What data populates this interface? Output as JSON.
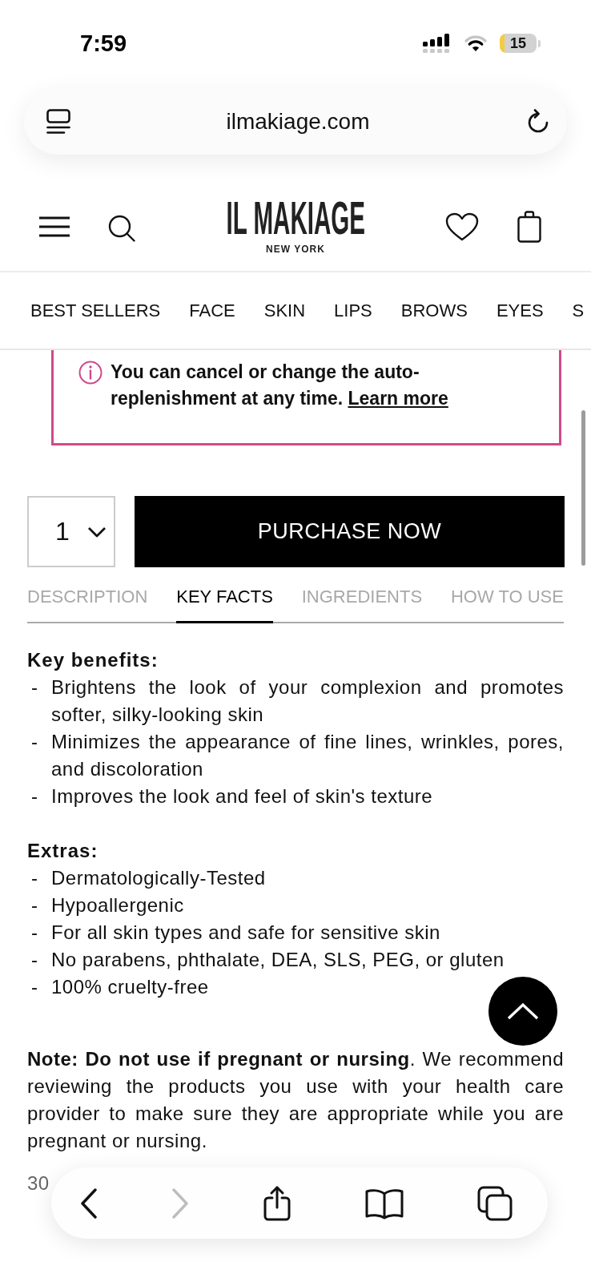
{
  "status_bar": {
    "time": "7:59",
    "battery": "15"
  },
  "browser": {
    "url": "ilmakiage.com"
  },
  "header": {
    "logo": "IL MAKIAGE",
    "tagline": "NEW YORK"
  },
  "nav": [
    "BEST SELLERS",
    "FACE",
    "SKIN",
    "LIPS",
    "BROWS",
    "EYES",
    "S"
  ],
  "notice": {
    "text": "You can cancel or change the auto-replenishment at any time.",
    "link": "Learn more"
  },
  "purchase": {
    "quantity": "1",
    "button": "PURCHASE NOW"
  },
  "tabs": [
    {
      "label": "DESCRIPTION",
      "selected": false
    },
    {
      "label": "KEY FACTS",
      "selected": true
    },
    {
      "label": "INGREDIENTS",
      "selected": false
    },
    {
      "label": "HOW TO USE",
      "selected": false
    }
  ],
  "sections": [
    {
      "heading": "Key benefits:",
      "items": [
        {
          "bullet": "-",
          "text": "Brightens the look of your complexion and promotes softer, silky-looking skin"
        },
        {
          "bullet": "-",
          "text": "Minimizes the appearance of fine lines, wrinkles, pores, and discoloration"
        },
        {
          "bullet": "-",
          "text": "Improves the look and feel of skin's texture"
        }
      ]
    },
    {
      "heading": "Extras:",
      "items": [
        {
          "bullet": "-",
          "text": "Dermatologically-Tested"
        },
        {
          "bullet": "-",
          "text": "Hypoallergenic"
        },
        {
          "bullet": "-",
          "text": "For all skin types and safe for sensitive skin"
        },
        {
          "bullet": "-",
          "text": "No parabens, phthalate, DEA, SLS, PEG, or gluten"
        },
        {
          "bullet": "-",
          "text": "100% cruelty-free"
        }
      ]
    }
  ],
  "note": "**Note: Do not use if pregnant or nursing**. We recommend reviewing the products you use with your health care provider to make sure they are appropriate while you are pregnant or nursing.",
  "size": "30",
  "toolbar": [
    {
      "kind": "back",
      "disabled": false
    },
    {
      "kind": "forward",
      "disabled": true
    },
    {
      "kind": "share",
      "disabled": false
    },
    {
      "kind": "bookmarks",
      "disabled": false
    },
    {
      "kind": "tabs",
      "disabled": false
    }
  ]
}
